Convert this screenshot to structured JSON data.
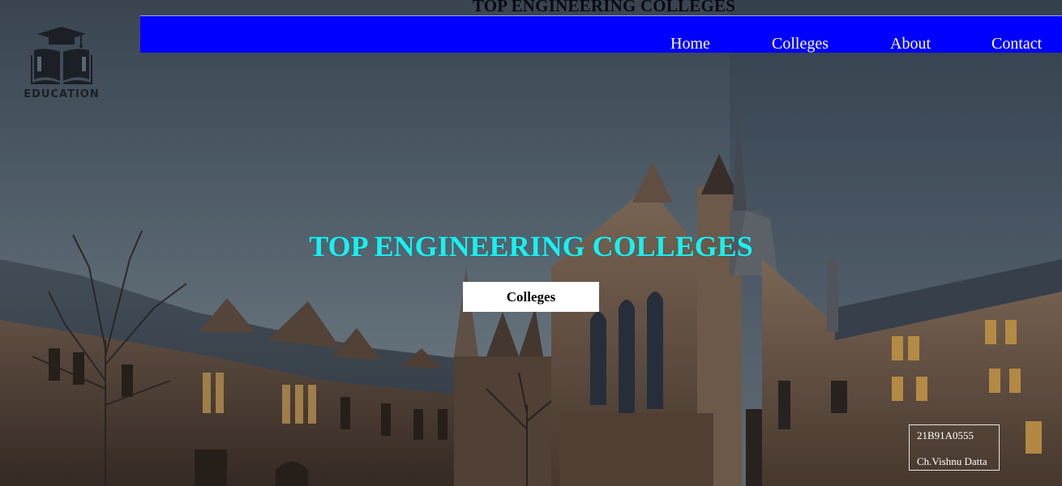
{
  "page": {
    "top_title": "TOP ENGINEERING COLLEGES"
  },
  "logo": {
    "text": "EDUCATION",
    "icon": "graduation-cap-book-icon"
  },
  "nav": {
    "items": [
      {
        "label": "Home"
      },
      {
        "label": "Colleges"
      },
      {
        "label": "About"
      },
      {
        "label": "Contact"
      }
    ]
  },
  "hero": {
    "title": "TOP ENGINEERING COLLEGES",
    "button_label": "Colleges"
  },
  "info": {
    "roll": "21B91A0555",
    "name": "Ch.Vishnu Datta"
  },
  "colors": {
    "nav_background": "#0000ff",
    "hero_title": "#19f0f0",
    "button_background": "#ffffff"
  }
}
